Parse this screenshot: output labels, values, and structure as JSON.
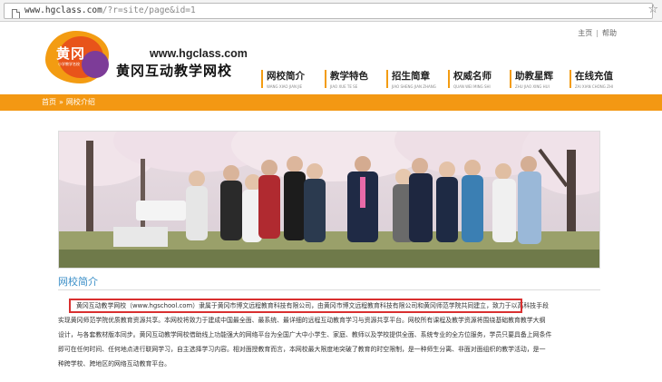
{
  "browser": {
    "url_host": "www.hgclass.com",
    "url_path": "/?r=site/page&id=1"
  },
  "toplinks": {
    "home": "主页",
    "help": "帮助"
  },
  "logo": {
    "text": "黄冈",
    "sub": "小学教学名校"
  },
  "site": {
    "url": "www.hgclass.com",
    "name": "黄冈互动教学网校"
  },
  "nav": [
    {
      "cn": "网校简介",
      "en": "WANG XIAO JIAN JIE"
    },
    {
      "cn": "教学特色",
      "en": "JIAO XUE TE SE"
    },
    {
      "cn": "招生简章",
      "en": "JIAO SHENG JIAN ZHANG"
    },
    {
      "cn": "权威名师",
      "en": "QUAN WEI MING SHI"
    },
    {
      "cn": "助教星辉",
      "en": "ZHU JIAO XING HUI"
    },
    {
      "cn": "在线充值",
      "en": "ZAI XIAN CHONG ZHI"
    }
  ],
  "breadcrumb": {
    "home": "首页",
    "sep": "»",
    "current": "网校介绍"
  },
  "section": {
    "title": "网校简介"
  },
  "content": {
    "line1_highlight": "黄冈互动教学网校（www.hgschool.com）隶属于黄冈市博文远程教育科技有限公司，由黄冈市博文远程教育科技有限公司和黄冈师范学院共同建立",
    "line1_rest": "，致力于以高科技手段",
    "line2": "实现黄冈师范学院优质教育资源共享。本网校将致力于建成中国最全面、最系统、最详细的远程互动教育学习与资源共享平台。网校所有课程及教学资源将围绕基础教育教学大纲",
    "line3": "设计，与各套教材版本同步。黄冈互动教学网校借助线上功能强大的网络平台为全国广大中小学生、家庭、教师以及学校提供全面、系统专业的全方位服务，学员只要具备上网条件",
    "line4": "即可在任何时间、任何地点进行联网学习，自主选择学习内容。相对面授教育而言，本网校最大限度地突破了教育的时空限制，是一种师生分离、非面对面组织的教学活动，是一",
    "line5": "种跨学校、跨地区的网络互动教育平台。"
  },
  "colors": {
    "accent": "#f39813",
    "title_blue": "#3a8ec7",
    "highlight": "#d93030"
  }
}
